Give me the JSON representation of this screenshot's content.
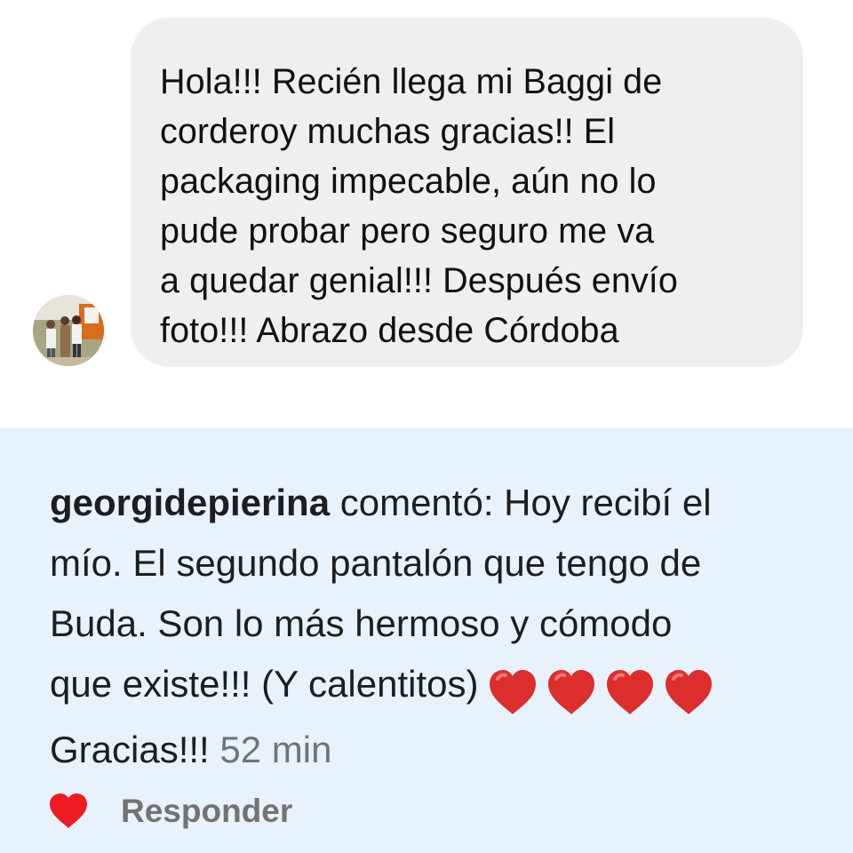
{
  "message": {
    "text": "Hola!!! Recién llega mi Baggi de\ncorderoy muchas gracias!! El\npackaging impecable, aún no lo\npude probar pero seguro me va\na quedar genial!!! Después envío\nfoto!!! Abrazo desde Córdoba",
    "avatar_icon": "profile-photo",
    "bubble_color": "#efefef"
  },
  "comment": {
    "username": "georgidepierina",
    "line1": " comentó: Hoy recibí el",
    "line2": "mío. El segundo pantalón que tengo de",
    "line3": "Buda. Son lo más hermoso y cómodo",
    "line4": "que existe!!! (Y calentitos)",
    "line5": "Gracias!!! ",
    "timestamp": "52 min",
    "hearts": [
      "red-heart-emoji",
      "red-heart-emoji",
      "red-heart-emoji",
      "red-heart-emoji"
    ],
    "panel_color": "#e8f2fd"
  },
  "actions": {
    "like_icon": "heart-icon",
    "like_color": "#ed1c24",
    "reply_label": "Responder"
  }
}
